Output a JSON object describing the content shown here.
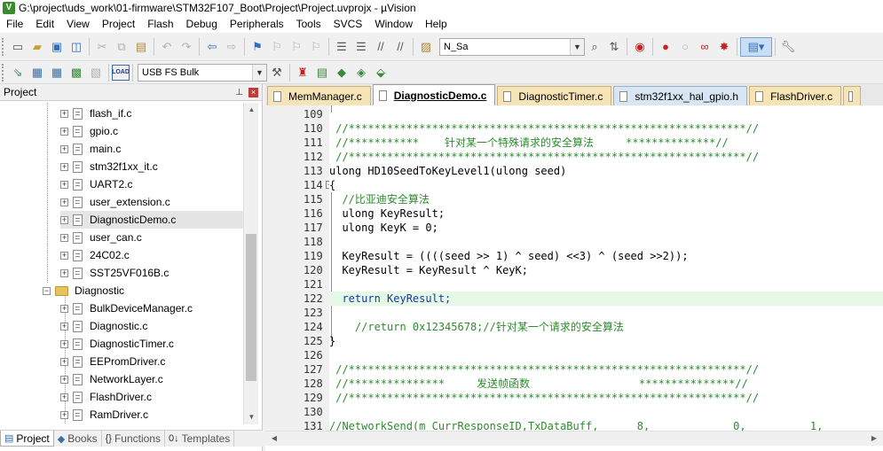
{
  "window": {
    "title": "G:\\project\\uds_work\\01-firmware\\STM32F107_Boot\\Project\\Project.uvprojx - µVision",
    "app_icon": "V"
  },
  "menu": [
    "File",
    "Edit",
    "View",
    "Project",
    "Flash",
    "Debug",
    "Peripherals",
    "Tools",
    "SVCS",
    "Window",
    "Help"
  ],
  "toolbar": {
    "find_combo": "N_Sa",
    "target_combo": "USB FS Bulk",
    "load_label": "LOAD"
  },
  "project_pane": {
    "title": "Project",
    "files_top": [
      "flash_if.c",
      "gpio.c",
      "main.c",
      "stm32f1xx_it.c",
      "UART2.c",
      "user_extension.c",
      "DiagnosticDemo.c",
      "user_can.c",
      "24C02.c",
      "SST25VF016B.c"
    ],
    "selected_file": "DiagnosticDemo.c",
    "folder": "Diagnostic",
    "folder_files": [
      "BulkDeviceManager.c",
      "Diagnostic.c",
      "DiagnosticTimer.c",
      "EEPromDriver.c",
      "NetworkLayer.c",
      "FlashDriver.c",
      "RamDriver.c"
    ],
    "tabs": [
      {
        "label": "Project",
        "icon": "▤"
      },
      {
        "label": "Books",
        "icon": "◆"
      },
      {
        "label": "Functions",
        "icon": "{}"
      },
      {
        "label": "Templates",
        "icon": "0↓"
      }
    ]
  },
  "editor": {
    "tabs": [
      "MemManager.c",
      "DiagnosticDemo.c",
      "DiagnosticTimer.c",
      "stm32f1xx_hal_gpio.h",
      "FlashDriver.c"
    ],
    "active_tab": "DiagnosticDemo.c",
    "lines": [
      {
        "n": "109",
        "text": ""
      },
      {
        "n": "110",
        "text": " //**************************************************************//"
      },
      {
        "n": "111",
        "text": " //***********    针对某一个特殊请求的安全算法     **************//"
      },
      {
        "n": "112",
        "text": " //**************************************************************//"
      },
      {
        "n": "113",
        "text": "ulong HD10SeedToKeyLevel1(ulong seed)"
      },
      {
        "n": "114",
        "text": "{"
      },
      {
        "n": "115",
        "text": "  //比亚迪安全算法"
      },
      {
        "n": "116",
        "text": "  ulong KeyResult;"
      },
      {
        "n": "117",
        "text": "  ulong KeyK = 0;"
      },
      {
        "n": "118",
        "text": ""
      },
      {
        "n": "119",
        "text": "  KeyResult = ((((seed >> 1) ^ seed) <<3) ^ (seed >>2));"
      },
      {
        "n": "120",
        "text": "  KeyResult = KeyResult ^ KeyK;"
      },
      {
        "n": "121",
        "text": ""
      },
      {
        "n": "122",
        "text": "  return KeyResult;"
      },
      {
        "n": "123",
        "text": ""
      },
      {
        "n": "124",
        "text": "    //return 0x12345678;//针对某一个请求的安全算法"
      },
      {
        "n": "125",
        "text": "}"
      },
      {
        "n": "126",
        "text": ""
      },
      {
        "n": "127",
        "text": " //**************************************************************//"
      },
      {
        "n": "128",
        "text": " //***************     发送帧函数                 ***************//"
      },
      {
        "n": "129",
        "text": " //**************************************************************//"
      },
      {
        "n": "130",
        "text": ""
      },
      {
        "n": "131",
        "text": "//NetworkSend(m_CurrResponseID,TxDataBuff,      8,             0,          1,"
      }
    ]
  }
}
